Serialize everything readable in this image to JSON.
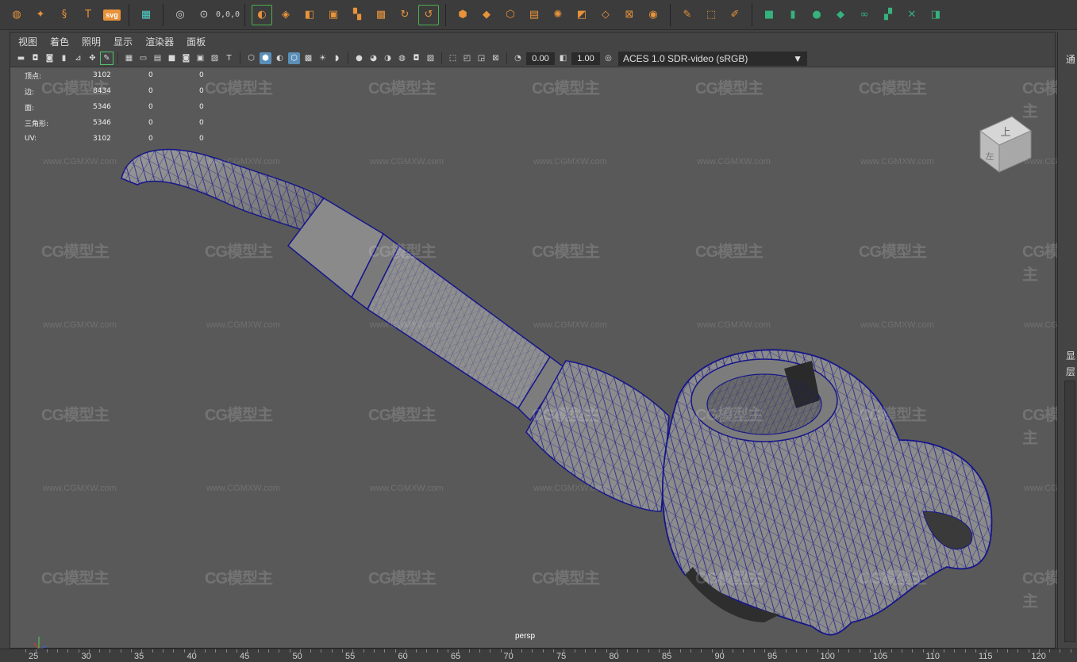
{
  "shelf": {
    "svg_label": "svg",
    "coord_label": "0,0,0"
  },
  "panel_menu": [
    "视图",
    "着色",
    "照明",
    "显示",
    "渲染器",
    "面板"
  ],
  "panel_toolbar": {
    "exposure_value": "0.00",
    "gamma_value": "1.00",
    "color_space": "ACES 1.0 SDR-video (sRGB)"
  },
  "hud": {
    "rows": [
      {
        "label": "顶点:",
        "value": "3102",
        "sel": "0",
        "other": "0"
      },
      {
        "label": "边:",
        "value": "8434",
        "sel": "0",
        "other": "0"
      },
      {
        "label": "面:",
        "value": "5346",
        "sel": "0",
        "other": "0"
      },
      {
        "label": "三角形:",
        "value": "5346",
        "sel": "0",
        "other": "0"
      },
      {
        "label": "UV:",
        "value": "3102",
        "sel": "0",
        "other": "0"
      }
    ]
  },
  "viewcube": {
    "top_label": "上",
    "front_label": "左"
  },
  "camera_label": "persp",
  "right_strip": {
    "top_label": "通",
    "mid_label_1": "显",
    "mid_label_2": "层"
  },
  "ruler": {
    "ticks": [
      "25",
      "30",
      "35",
      "40",
      "45",
      "50",
      "55",
      "60",
      "65",
      "70",
      "75",
      "80",
      "85",
      "90",
      "95",
      "100",
      "105",
      "110",
      "115",
      "120"
    ]
  },
  "watermark": {
    "logo": "CG模型主",
    "url": "www.CGMXW.com"
  },
  "colors": {
    "wire": "#16168a",
    "mesh_fill": "#8d8d8d",
    "viewport_bg": "#595959"
  }
}
